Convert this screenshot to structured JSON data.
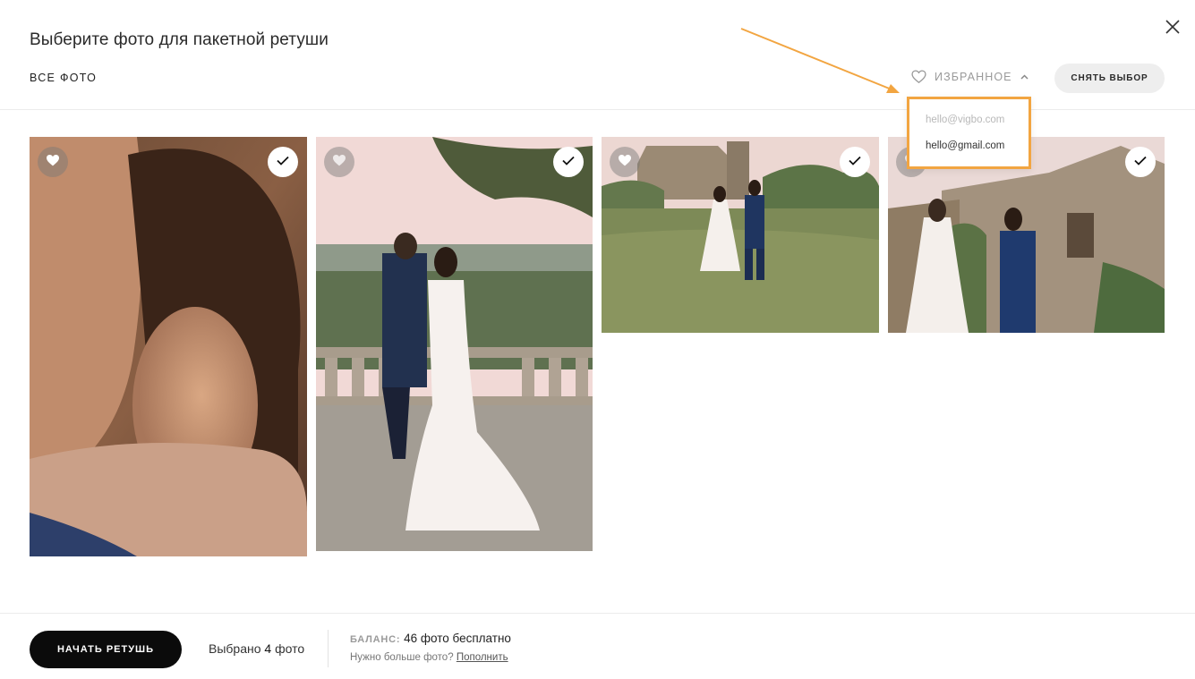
{
  "header": {
    "title": "Выберите фото для пакетной ретуши",
    "close_icon": "close-icon"
  },
  "tabs": {
    "all_label": "ВСЕ ФОТО",
    "favorites_label": "ИЗБРАННОЕ",
    "favorites_icon": "heart-outline-icon",
    "chevron_icon": "chevron-up-icon"
  },
  "actions": {
    "deselect_label": "СНЯТЬ ВЫБОР"
  },
  "favorites_dropdown": {
    "options": [
      "hello@vigbo.com",
      "hello@gmail.com"
    ],
    "highlight_color": "#f2a541"
  },
  "photos": [
    {
      "favorite": true,
      "selected": true
    },
    {
      "favorite": false,
      "selected": true
    },
    {
      "favorite": true,
      "selected": true
    },
    {
      "favorite": false,
      "selected": true
    }
  ],
  "footer": {
    "start_label": "НАЧАТЬ РЕТУШЬ",
    "selected_prefix": "Выбрано",
    "selected_count": "4",
    "selected_suffix": "фото",
    "balance_label": "БАЛАНС:",
    "balance_value": "46 фото бесплатно",
    "more_text": "Нужно больше фото?",
    "more_link": "Пополнить"
  },
  "colors": {
    "accent": "#f2a541",
    "primary_button": "#0b0b0b",
    "secondary_button": "#eeeeee"
  }
}
